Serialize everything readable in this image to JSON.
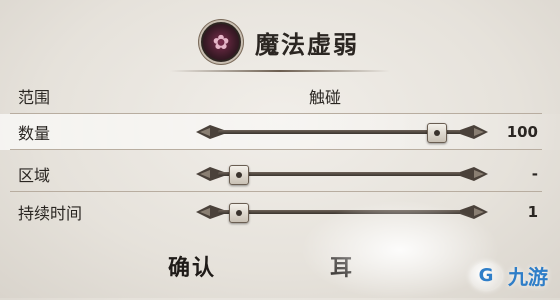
{
  "spell": {
    "title": "魔法虚弱",
    "icon": "spell-flower-icon"
  },
  "rows": [
    {
      "label": "范围",
      "value": "触碰"
    },
    {
      "label": "数量",
      "value": "100",
      "slider_level": 0.88
    },
    {
      "label": "区域",
      "value": "-",
      "slider_level": 0.08
    },
    {
      "label": "持续时间",
      "value": "1",
      "slider_level": 0.08
    }
  ],
  "buttons": {
    "confirm": "确认",
    "partial": "耳"
  },
  "watermark": {
    "text": "九游",
    "icon": "jiuyou-logo-icon"
  },
  "colors": {
    "background": "#e9e5df",
    "highlight_row": "#ffffff",
    "track": "#4a413a",
    "watermark": "#2f7ec8"
  }
}
